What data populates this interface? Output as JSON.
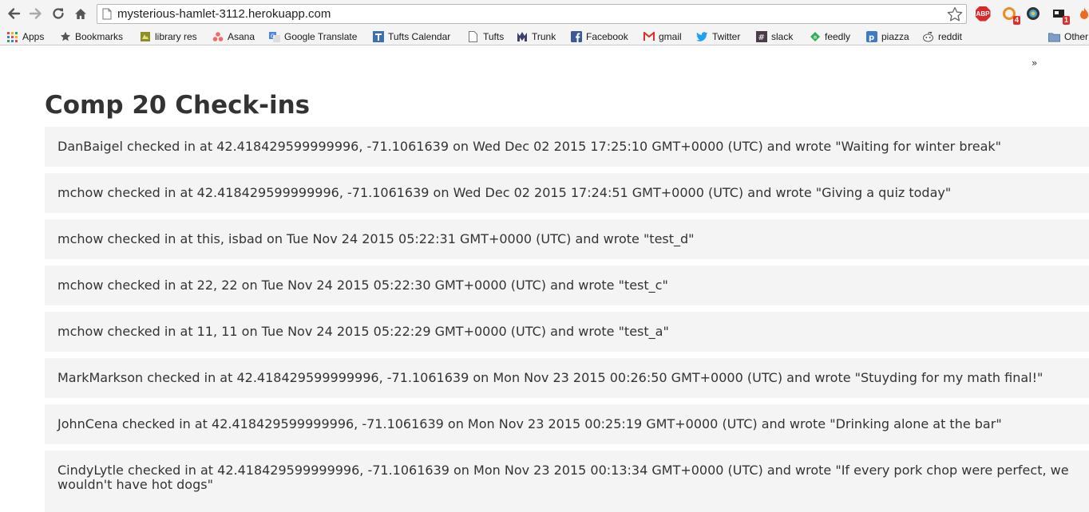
{
  "browser": {
    "url": "mysterious-hamlet-3112.herokuapp.com",
    "extensions": [
      {
        "name": "adblock-plus",
        "label": "ABP"
      },
      {
        "name": "extension-badge-4",
        "badge": "4"
      },
      {
        "name": "extension-badge-1",
        "badge": "1"
      }
    ]
  },
  "bookmarks": {
    "items": [
      {
        "label": "Apps",
        "icon": "apps-grid-icon"
      },
      {
        "label": "Bookmarks",
        "icon": "star-icon"
      },
      {
        "label": "library res",
        "icon": "library-icon"
      },
      {
        "label": "Asana",
        "icon": "asana-icon"
      },
      {
        "label": "Google Translate",
        "icon": "translate-icon"
      },
      {
        "label": "Tufts Calendar",
        "icon": "calendar-icon"
      },
      {
        "label": "Tufts",
        "icon": "page-icon"
      },
      {
        "label": "Trunk",
        "icon": "trunk-icon"
      },
      {
        "label": "Facebook",
        "icon": "facebook-icon"
      },
      {
        "label": "gmail",
        "icon": "gmail-icon"
      },
      {
        "label": "Twitter",
        "icon": "twitter-icon"
      },
      {
        "label": "slack",
        "icon": "slack-icon"
      },
      {
        "label": "feedly",
        "icon": "feedly-icon"
      },
      {
        "label": "piazza",
        "icon": "piazza-icon"
      },
      {
        "label": "reddit",
        "icon": "reddit-icon"
      }
    ],
    "overflow_label": "»",
    "other_label": "Other"
  },
  "page": {
    "title": "Comp 20 Check-ins",
    "checkins": [
      "DanBaigel checked in at 42.418429599999996, -71.1061639 on Wed Dec 02 2015 17:25:10 GMT+0000 (UTC) and wrote \"Waiting for winter break\"",
      "mchow checked in at 42.418429599999996, -71.1061639 on Wed Dec 02 2015 17:24:51 GMT+0000 (UTC) and wrote \"Giving a quiz today\"",
      "mchow checked in at this, isbad on Tue Nov 24 2015 05:22:31 GMT+0000 (UTC) and wrote \"test_d\"",
      "mchow checked in at 22, 22 on Tue Nov 24 2015 05:22:30 GMT+0000 (UTC) and wrote \"test_c\"",
      "mchow checked in at 11, 11 on Tue Nov 24 2015 05:22:29 GMT+0000 (UTC) and wrote \"test_a\"",
      "MarkMarkson checked in at 42.418429599999996, -71.1061639 on Mon Nov 23 2015 00:26:50 GMT+0000 (UTC) and wrote \"Stuyding for my math final!\"",
      "JohnCena checked in at 42.418429599999996, -71.1061639 on Mon Nov 23 2015 00:25:19 GMT+0000 (UTC) and wrote \"Drinking alone at the bar\"",
      "CindyLytle checked in at 42.418429599999996, -71.1061639 on Mon Nov 23 2015 00:13:34 GMT+0000 (UTC) and wrote \"If every pork chop were perfect, we wouldn't have hot dogs\""
    ]
  }
}
